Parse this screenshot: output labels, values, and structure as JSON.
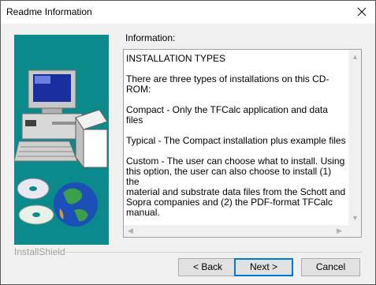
{
  "window": {
    "title": "Readme Information"
  },
  "content": {
    "info_label": "Information:",
    "text": "INSTALLATION TYPES\n\nThere are three types of installations on this CD-ROM:\n\nCompact - Only the TFCalc application and data files\n\nTypical - The Compact installation plus example files\n\nCustom  - The user can choose what to install.  Using\nthis option, the user can also choose to install (1) the\nmaterial and substrate data files from the Schott and\nSopra companies and (2) the PDF-format TFCalc manual."
  },
  "footer": {
    "brand": "InstallShield",
    "back_label": "< Back",
    "next_label": "Next >",
    "cancel_label": "Cancel"
  },
  "icons": {
    "close": "close-icon",
    "illustration": "computer-cd-globe-illustration"
  },
  "colors": {
    "panel": "#0a8a8a",
    "button_focus": "#0078d7"
  }
}
